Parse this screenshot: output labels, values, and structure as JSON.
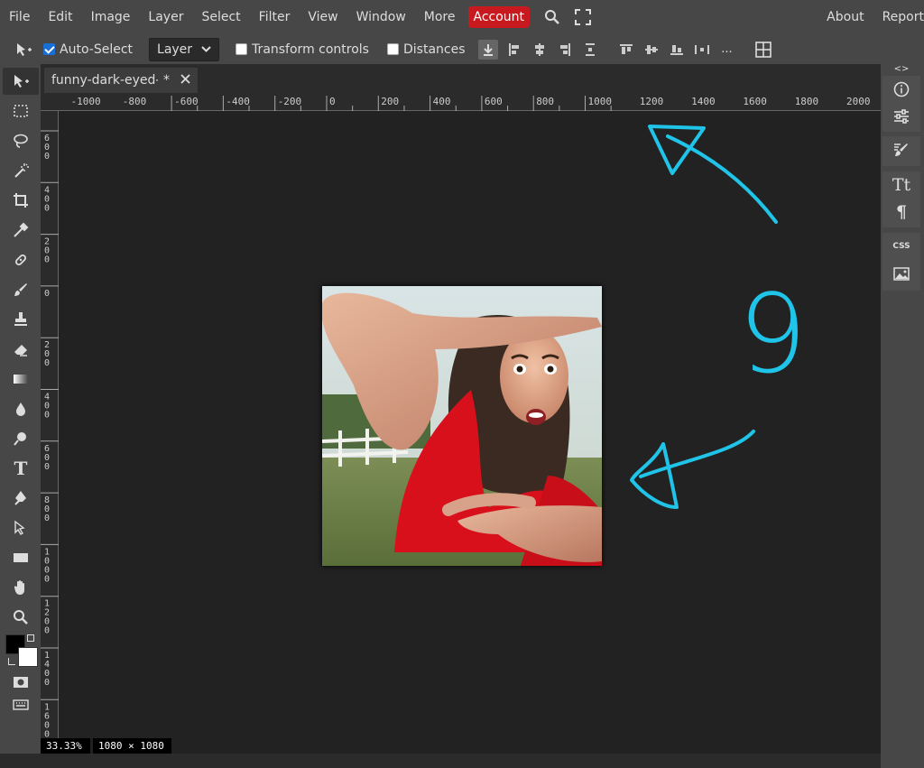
{
  "menu": {
    "items": [
      "File",
      "Edit",
      "Image",
      "Layer",
      "Select",
      "Filter",
      "View",
      "Window",
      "More"
    ],
    "account": "Account",
    "right_items": [
      "About",
      "Report"
    ]
  },
  "options": {
    "auto_select_label": "Auto-Select",
    "auto_select_checked": true,
    "layer_select_value": "Layer",
    "transform_label": "Transform controls",
    "distances_label": "Distances",
    "more_label": "..."
  },
  "document": {
    "tab_title": "funny-dark-eyed-",
    "modified_marker": "*"
  },
  "ruler": {
    "h_labels": [
      "-1000",
      "-800",
      "-600",
      "-400",
      "-200",
      "0",
      "200",
      "400",
      "600",
      "800",
      "1000",
      "1200",
      "1400",
      "1600",
      "1800",
      "2000"
    ],
    "v_labels": [
      "600",
      "400",
      "200",
      "0",
      "200",
      "400",
      "600",
      "800",
      "1000",
      "1200",
      "1400",
      "1600"
    ]
  },
  "status": {
    "zoom": "33.33%",
    "size": "1080 × 1080"
  },
  "right_panel": {
    "css_label": "CSS",
    "collapse_label": "<>"
  },
  "colors": {
    "accent": "#c8191e",
    "annotation": "#1fc4e8",
    "foreground_swatch": "#000000",
    "background_swatch": "#ffffff"
  },
  "annotation": {
    "number_text": "9"
  }
}
